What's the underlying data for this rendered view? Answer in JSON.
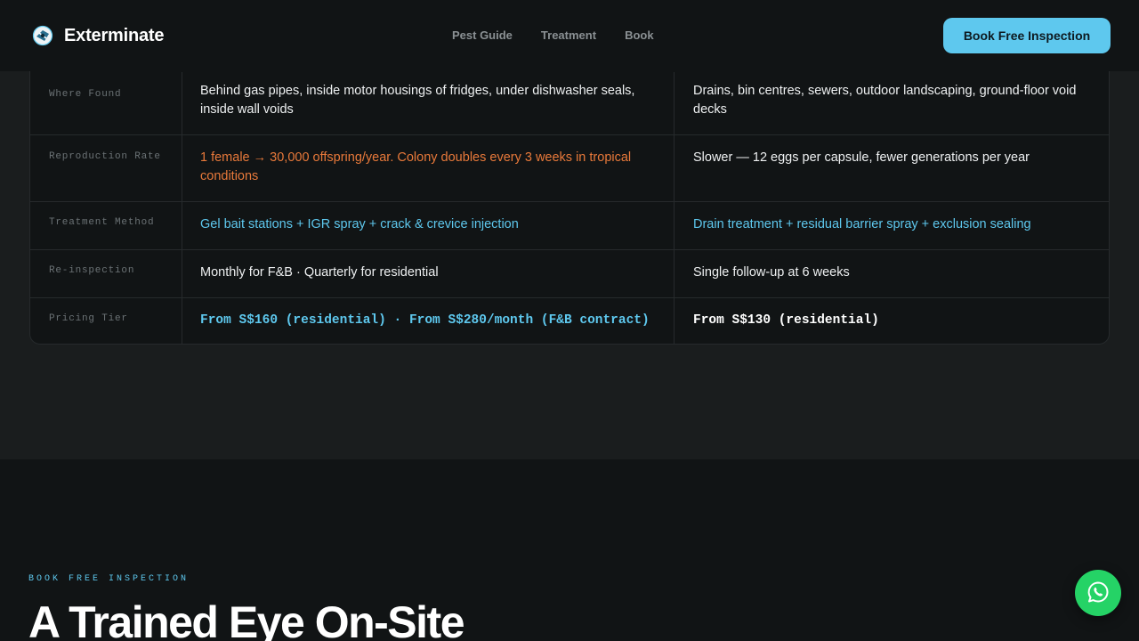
{
  "brand": {
    "name": "Exterminate"
  },
  "nav": {
    "items": [
      "Pest Guide",
      "Treatment",
      "Book"
    ]
  },
  "header": {
    "cta_label": "Book Free Inspection"
  },
  "table": {
    "rows": [
      {
        "label": "Where Found",
        "a": "Behind gas pipes, inside motor housings of fridges, under dishwasher seals, inside wall voids",
        "b": "Drains, bin centres, sewers, outdoor landscaping, ground-floor void decks"
      },
      {
        "label": "Reproduction Rate",
        "a": "1 female → 30,000 offspring/year. Colony doubles every 3 weeks in tropical conditions",
        "b": "Slower — 12 eggs per capsule, fewer generations per year"
      },
      {
        "label": "Treatment Method",
        "a": "Gel bait stations + IGR spray + crack & crevice injection",
        "b": "Drain treatment + residual barrier spray + exclusion sealing"
      },
      {
        "label": "Re-inspection",
        "a": "Monthly for F&B · Quarterly for residential",
        "b": "Single follow-up at 6 weeks"
      },
      {
        "label": "Pricing Tier",
        "a": "From S$160 (residential) · From S$280/month (F&B contract)",
        "b": "From S$130 (residential)"
      }
    ]
  },
  "booking": {
    "eyebrow": "BOOK FREE INSPECTION",
    "title": "A Trained Eye On-Site"
  },
  "icons": {
    "logo": "bug-logo-icon",
    "chat": "whatsapp-icon"
  },
  "colors": {
    "accent": "#5ec8ee",
    "warning": "#e8793a",
    "whatsapp": "#25d366",
    "background": "#1a1d1e",
    "surface": "#111415"
  }
}
